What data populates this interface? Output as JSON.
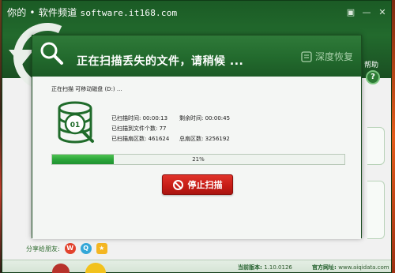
{
  "app": {
    "title_cn": "你的 • 软件频道",
    "title_url": "software.it168.com",
    "window_buttons": [
      "▣",
      "—",
      "✕"
    ],
    "help_label": "帮助",
    "help_icon": "?",
    "share_label": "分享给朋友:",
    "version_label": "当前版本:",
    "version": "1.10.0126",
    "site_label": "官方网址:",
    "site_url": "www.aiqidata.com"
  },
  "dialog": {
    "title": "正在扫描丢失的文件，请稍候 ...",
    "brand": "深度恢复",
    "scan_target": "正在扫描  可移动磁盘 (D:) ...",
    "stats": {
      "elapsed_label": "已扫描时间:",
      "elapsed": "00:00:13",
      "remaining_label": "剩余时间:",
      "remaining": "00:00:45",
      "found_label": "已扫描到文件个数:",
      "found": "77",
      "sectors_label": "已扫描扇区数:",
      "sectors": "461624",
      "total_label": "总扇区数:",
      "total": "3256192"
    },
    "progress_text": "21%",
    "progress_value": 21,
    "stop_label": "停止扫描"
  },
  "colors": {
    "header_green": "#226a2d",
    "progress_green": "#2ca73a",
    "stop_red": "#c51b15"
  },
  "icons": [
    "magnifier-icon",
    "brand-icon",
    "database-icon",
    "stop-icon",
    "help-icon",
    "weibo-icon",
    "tencent-weibo-icon",
    "qzone-icon"
  ]
}
